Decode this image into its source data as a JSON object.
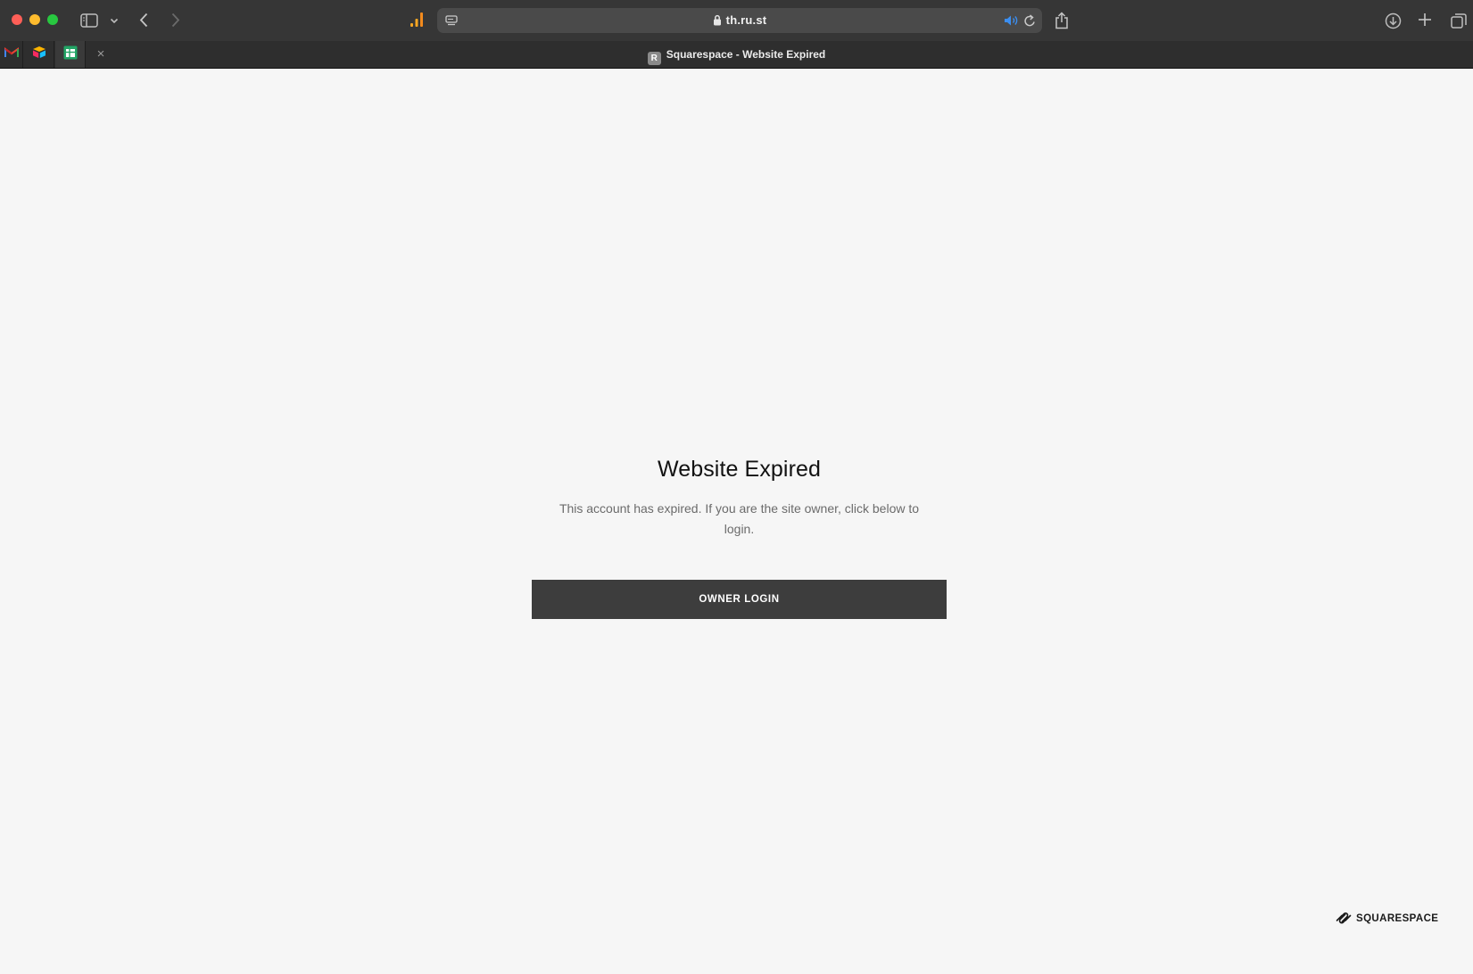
{
  "browser": {
    "address": "th.ru.st",
    "active_tab_title": "Squarespace - Website Expired",
    "active_tab_favicon_letter": "R",
    "close_tab_glyph": "×",
    "icons": [
      "sidebar-icon",
      "chevron-down-icon",
      "back-icon",
      "forward-icon",
      "stats-icon",
      "reader-icon",
      "lock-icon",
      "audio-icon",
      "reload-icon",
      "share-icon",
      "download-icon",
      "new-tab-icon",
      "tab-overview-icon"
    ],
    "pinned_tabs": [
      "gmail-icon",
      "cube-app-icon",
      "sheets-icon"
    ]
  },
  "page": {
    "heading": "Website Expired",
    "message": "This account has expired. If you are the site owner, click below to login.",
    "button_label": "OWNER LOGIN",
    "brand": "SQUARESPACE"
  },
  "colors": {
    "page_background": "#f6f6f6",
    "button_background": "#3d3d3d",
    "toolbar": "#363636",
    "audio_icon": "#3b8ef0"
  }
}
